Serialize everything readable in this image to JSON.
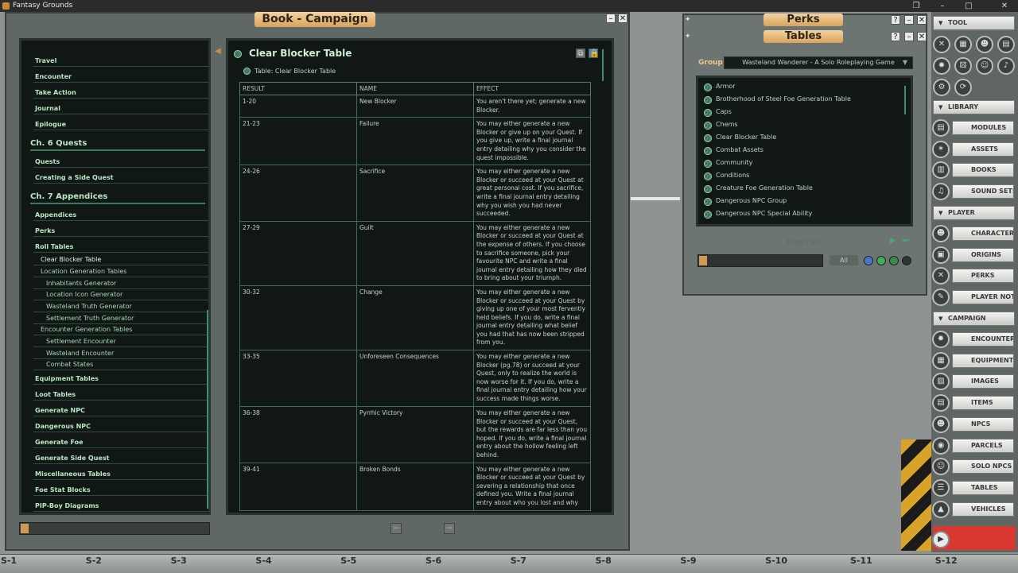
{
  "app": {
    "title": "Fantasy Grounds"
  },
  "window_controls": {
    "restore": "❐",
    "minimize": "–",
    "maximize": "□",
    "close": "✕"
  },
  "book": {
    "title": "Book - Campaign",
    "toc": [
      {
        "label": "Travel",
        "level": "item"
      },
      {
        "label": "Encounter",
        "level": "item"
      },
      {
        "label": "Take Action",
        "level": "item"
      },
      {
        "label": "Journal",
        "level": "item"
      },
      {
        "label": "Epilogue",
        "level": "item"
      },
      {
        "label": "Ch. 6 Quests",
        "level": "chapter"
      },
      {
        "label": "Quests",
        "level": "item"
      },
      {
        "label": "Creating a Side Quest",
        "level": "item"
      },
      {
        "label": "Ch. 7 Appendices",
        "level": "chapter"
      },
      {
        "label": "Appendices",
        "level": "item"
      },
      {
        "label": "Perks",
        "level": "item"
      },
      {
        "label": "Roll Tables",
        "level": "item"
      },
      {
        "label": "Clear Blocker Table",
        "level": "sub1"
      },
      {
        "label": "Location Generation Tables",
        "level": "sub1"
      },
      {
        "label": "Inhabitants Generator",
        "level": "sub2"
      },
      {
        "label": "Location Icon Generator",
        "level": "sub2"
      },
      {
        "label": "Wasteland Truth Generator",
        "level": "sub2"
      },
      {
        "label": "Settlement Truth Generator",
        "level": "sub2"
      },
      {
        "label": "Encounter Generation Tables",
        "level": "sub1"
      },
      {
        "label": "Settlement Encounter",
        "level": "sub2"
      },
      {
        "label": "Wasteland Encounter",
        "level": "sub2"
      },
      {
        "label": "Combat States",
        "level": "sub2"
      },
      {
        "label": "Equipment Tables",
        "level": "item"
      },
      {
        "label": "Loot Tables",
        "level": "item"
      },
      {
        "label": "Generate NPC",
        "level": "item"
      },
      {
        "label": "Dangerous NPC",
        "level": "item"
      },
      {
        "label": "Generate Foe",
        "level": "item"
      },
      {
        "label": "Generate Side Quest",
        "level": "item"
      },
      {
        "label": "Miscellaneous Tables",
        "level": "item"
      },
      {
        "label": "Foe Stat Blocks",
        "level": "item"
      },
      {
        "label": "PIP-Boy Diagrams",
        "level": "item"
      }
    ],
    "content": {
      "title": "Clear Blocker Table",
      "link_label": "Table: Clear Blocker Table",
      "columns": [
        "RESULT",
        "NAME",
        "EFFECT"
      ],
      "rows": [
        {
          "result": "1-20",
          "name": "New Blocker",
          "effect": "You aren't there yet; generate a new Blocker."
        },
        {
          "result": "21-23",
          "name": "Failure",
          "effect": "You may either generate a new Blocker or give up on your Quest. If you give up, write a final journal entry detailing why you consider the quest impossible."
        },
        {
          "result": "24-26",
          "name": "Sacrifice",
          "effect": "You may either generate a new Blocker or succeed at your Quest at great personal cost. If you sacrifice, write a final journal entry detailing why you wish you had never succeeded."
        },
        {
          "result": "27-29",
          "name": "Guilt",
          "effect": "You may either generate a new Blocker or succeed at your Quest at the expense of others. If you choose to sacrifice someone, pick your favourite NPC and write a final journal entry detailing how they died to bring about your triumph."
        },
        {
          "result": "30-32",
          "name": "Change",
          "effect": "You may either generate a new Blocker or succeed at your Quest by giving up one of your most fervently held beliefs. If you do, write a final journal entry detailing what belief you had that has now been stripped from you."
        },
        {
          "result": "33-35",
          "name": "Unforeseen Consequences",
          "effect": "You may either generate a new Blocker (pg.78) or succeed at your Quest, only to realize the world is now worse for it. If you do, write a final journal entry detailing how your success made things worse."
        },
        {
          "result": "36-38",
          "name": "Pyrrhic Victory",
          "effect": "You may either generate a new Blocker or succeed at your Quest, but the rewards are far less than you hoped. If you do, write a final journal entry about the hollow feeling left behind."
        },
        {
          "result": "39-41",
          "name": "Broken Bonds",
          "effect": "You may either generate a new Blocker or succeed at your Quest by severing a relationship that once defined you. Write a final journal entry about who you lost and why"
        }
      ],
      "prev_label": "⇦",
      "next_label": "⇨"
    }
  },
  "tables_window": {
    "perks_title": "Perks",
    "title": "Tables",
    "help": "?",
    "group_label": "Group",
    "group_value": "Wasteland Wanderer - A Solo Roleplaying Game",
    "items": [
      "Armor",
      "Brotherhood of Steel Foe Generation Table",
      "Caps",
      "Chems",
      "Clear Blocker Table",
      "Combat Assets",
      "Community",
      "Conditions",
      "Creature Foe Generation Table",
      "Dangerous NPC Group",
      "Dangerous NPC Special Ability"
    ],
    "page_label": "Page 1 of 2",
    "filter_all": "All"
  },
  "sidebar": {
    "tool_header": "TOOL",
    "library_header": "LIBRARY",
    "library": [
      "MODULES",
      "ASSETS",
      "BOOKS",
      "SOUND SETS"
    ],
    "player_header": "PLAYER",
    "player": [
      "CHARACTERS",
      "ORIGINS",
      "PERKS",
      "PLAYER NOTES"
    ],
    "campaign_header": "CAMPAIGN",
    "campaign": [
      "ENCOUNTERS",
      "EQUIPMENT PAC",
      "IMAGES",
      "ITEMS",
      "NPCS",
      "PARCELS",
      "SOLO NPCS",
      "TABLES",
      "VEHICLES"
    ]
  },
  "hotkeys": [
    "S-1",
    "S-2",
    "S-3",
    "S-4",
    "S-5",
    "S-6",
    "S-7",
    "S-8",
    "S-9",
    "S-10",
    "S-11",
    "S-12"
  ]
}
